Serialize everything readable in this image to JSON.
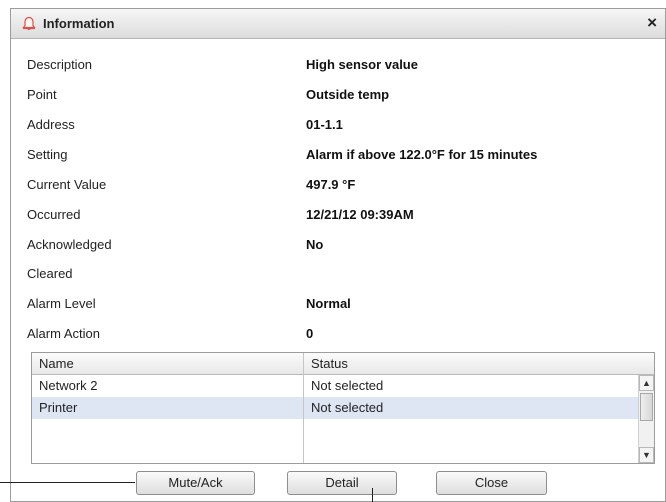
{
  "dialog": {
    "title": "Information",
    "title_icon": "bell-icon",
    "close_label": "×"
  },
  "fields": [
    {
      "label": "Description",
      "value": "High sensor value"
    },
    {
      "label": "Point",
      "value": "Outside temp"
    },
    {
      "label": "Address",
      "value": "01-1.1"
    },
    {
      "label": "Setting",
      "value": "Alarm if above 122.0°F for 15 minutes"
    },
    {
      "label": "Current Value",
      "value": "497.9 °F"
    },
    {
      "label": "Occurred",
      "value": "12/21/12 09:39AM"
    },
    {
      "label": "Acknowledged",
      "value": "No"
    },
    {
      "label": "Cleared",
      "value": ""
    },
    {
      "label": "Alarm Level",
      "value": "Normal"
    },
    {
      "label": "Alarm Action",
      "value": "0"
    }
  ],
  "table": {
    "columns": [
      "Name",
      "Status"
    ],
    "rows": [
      {
        "name": "Network 2",
        "status": "Not selected"
      },
      {
        "name": "Printer",
        "status": "Not selected"
      }
    ],
    "scroll_up_icon": "▲",
    "scroll_down_icon": "▼"
  },
  "buttons": {
    "mute_ack": "Mute/Ack",
    "detail": "Detail",
    "close": "Close"
  },
  "colors": {
    "selected_row": "#dfe6f3",
    "bell_icon": "#d9534f"
  }
}
